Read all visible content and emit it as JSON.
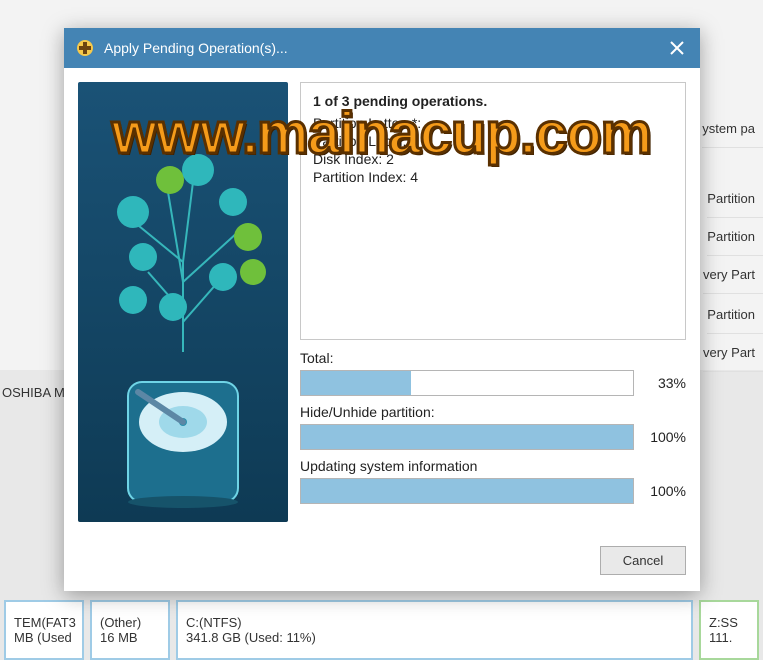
{
  "dialog": {
    "title": "Apply Pending Operation(s)...",
    "heading": "1 of 3 pending operations.",
    "details": {
      "partition_letter_label": "Partition Letter:",
      "partition_letter_value": "*:",
      "partition_label_label": "Partition Label:",
      "partition_label_value": "",
      "disk_index_label": "Disk Index:",
      "disk_index_value": "2",
      "partition_index_label": "Partition Index:",
      "partition_index_value": "4"
    },
    "progress": {
      "total": {
        "label": "Total:",
        "pct": 33
      },
      "hide": {
        "label": "Hide/Unhide partition:",
        "pct": 100
      },
      "update": {
        "label": "Updating system information",
        "pct": 100
      }
    },
    "cancel": "Cancel"
  },
  "watermark": "www.mainacup.com",
  "bg": {
    "rows": [
      "ystem pa",
      "Partition",
      "Partition",
      "very Part",
      "Partition",
      "very Part"
    ],
    "disk_label": "OSHIBA M",
    "parts": [
      {
        "l1": "TEM(FAT3",
        "l2": "MB (Used"
      },
      {
        "l1": "(Other)",
        "l2": "16 MB"
      },
      {
        "l1": "C:(NTFS)",
        "l2": "341.8 GB (Used: 11%)"
      },
      {
        "l1": "Z:SS",
        "l2": "111."
      }
    ]
  }
}
